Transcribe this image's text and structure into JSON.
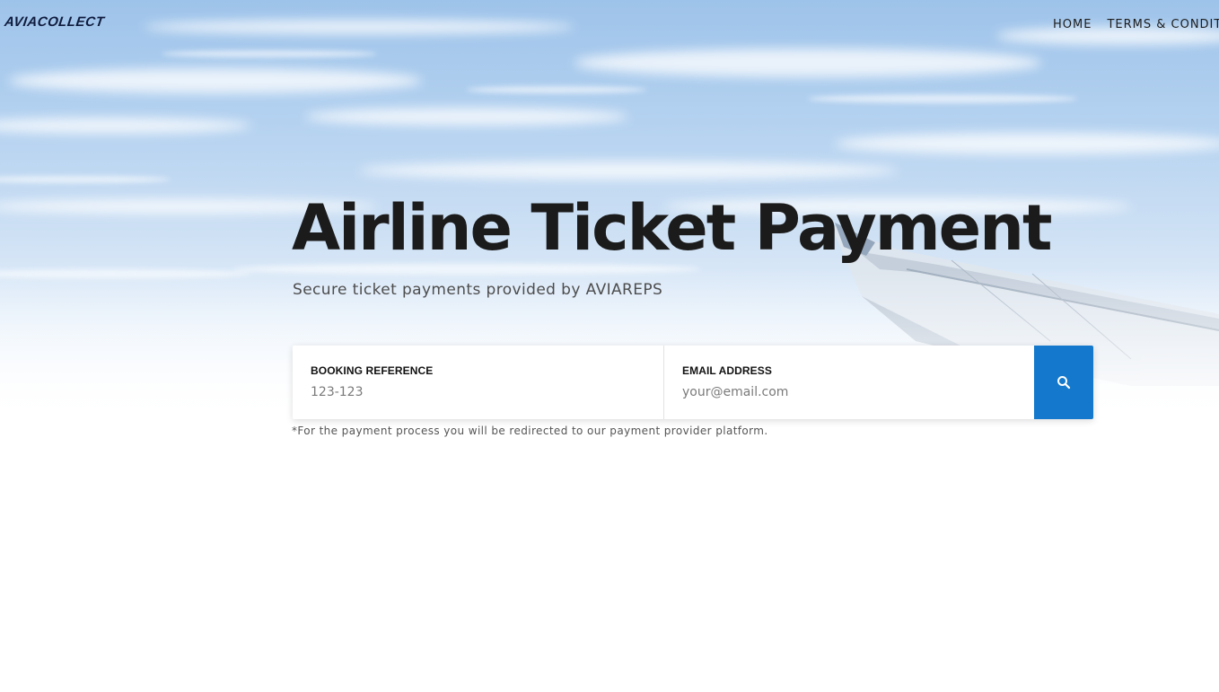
{
  "header": {
    "logo_text": "AVIACOLLECT",
    "nav": [
      {
        "label": "HOME"
      },
      {
        "label": "TERMS & CONDITIONS"
      }
    ]
  },
  "hero": {
    "title": "Airline Ticket Payment",
    "subtitle": "Secure ticket payments provided by AVIAREPS"
  },
  "form": {
    "booking_reference": {
      "label": "BOOKING REFERENCE",
      "placeholder": "123-123",
      "value": ""
    },
    "email": {
      "label": "EMAIL ADDRESS",
      "placeholder": "your@email.com",
      "value": ""
    },
    "search_button": {
      "icon": "search-icon",
      "color": "#1479cc"
    }
  },
  "note": "*For the payment process you will be redirected to our payment provider platform.",
  "colors": {
    "accent": "#1479cc",
    "title": "#1b1b1b",
    "sky": "#b5d2f0"
  }
}
